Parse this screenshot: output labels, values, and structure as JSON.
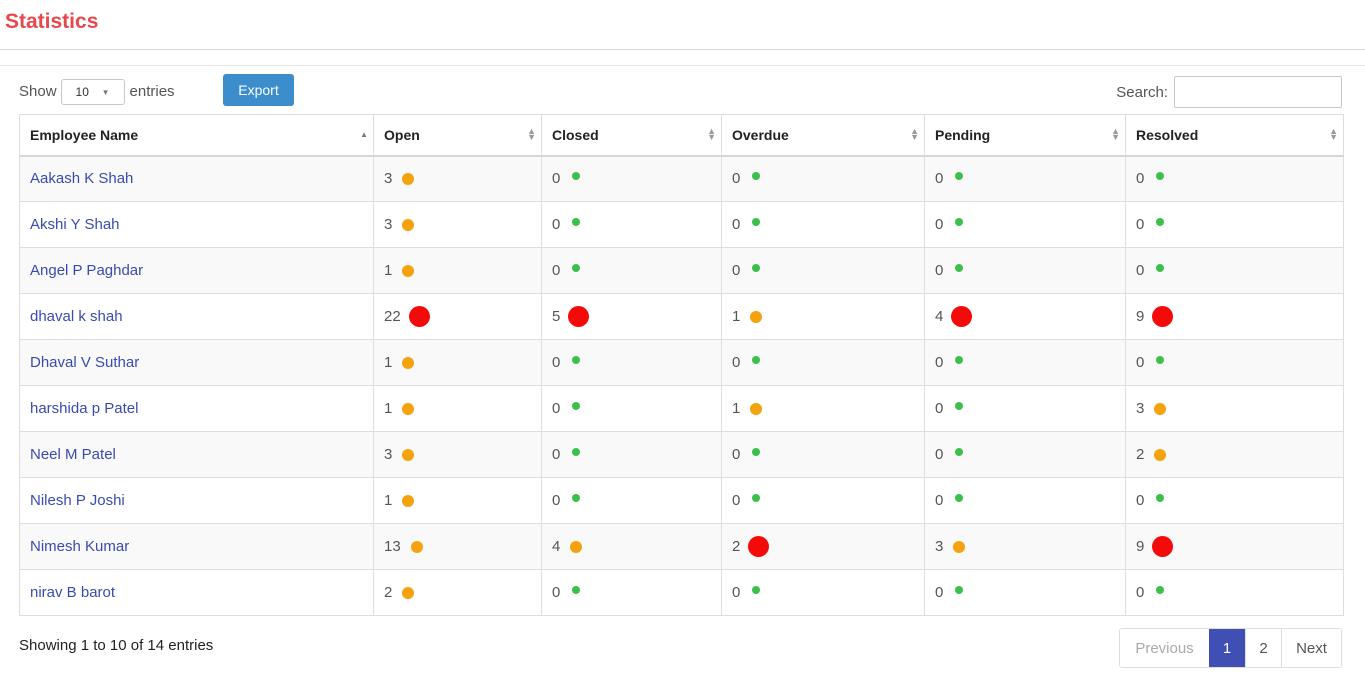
{
  "page": {
    "title": "Statistics"
  },
  "controls": {
    "show_label": "Show",
    "entries_label": "entries",
    "page_length": "10",
    "export_label": "Export",
    "search_label": "Search:",
    "search_value": ""
  },
  "table": {
    "headers": [
      "Employee Name",
      "Open",
      "Closed",
      "Overdue",
      "Pending",
      "Resolved"
    ],
    "rows": [
      {
        "name": "Aakash K Shah",
        "cells": [
          {
            "v": "3",
            "s": "md"
          },
          {
            "v": "0",
            "s": "sm"
          },
          {
            "v": "0",
            "s": "sm"
          },
          {
            "v": "0",
            "s": "sm"
          },
          {
            "v": "0",
            "s": "sm"
          }
        ]
      },
      {
        "name": "Akshi Y Shah",
        "cells": [
          {
            "v": "3",
            "s": "md"
          },
          {
            "v": "0",
            "s": "sm"
          },
          {
            "v": "0",
            "s": "sm"
          },
          {
            "v": "0",
            "s": "sm"
          },
          {
            "v": "0",
            "s": "sm"
          }
        ]
      },
      {
        "name": "Angel P Paghdar",
        "cells": [
          {
            "v": "1",
            "s": "md"
          },
          {
            "v": "0",
            "s": "sm"
          },
          {
            "v": "0",
            "s": "sm"
          },
          {
            "v": "0",
            "s": "sm"
          },
          {
            "v": "0",
            "s": "sm"
          }
        ]
      },
      {
        "name": "dhaval k shah",
        "cells": [
          {
            "v": "22",
            "s": "lg"
          },
          {
            "v": "5",
            "s": "lg"
          },
          {
            "v": "1",
            "s": "md"
          },
          {
            "v": "4",
            "s": "lg"
          },
          {
            "v": "9",
            "s": "lg"
          }
        ]
      },
      {
        "name": "Dhaval V Suthar",
        "cells": [
          {
            "v": "1",
            "s": "md"
          },
          {
            "v": "0",
            "s": "sm"
          },
          {
            "v": "0",
            "s": "sm"
          },
          {
            "v": "0",
            "s": "sm"
          },
          {
            "v": "0",
            "s": "sm"
          }
        ]
      },
      {
        "name": "harshida p Patel",
        "cells": [
          {
            "v": "1",
            "s": "md"
          },
          {
            "v": "0",
            "s": "sm"
          },
          {
            "v": "1",
            "s": "md"
          },
          {
            "v": "0",
            "s": "sm"
          },
          {
            "v": "3",
            "s": "md"
          }
        ]
      },
      {
        "name": "Neel M Patel",
        "cells": [
          {
            "v": "3",
            "s": "md"
          },
          {
            "v": "0",
            "s": "sm"
          },
          {
            "v": "0",
            "s": "sm"
          },
          {
            "v": "0",
            "s": "sm"
          },
          {
            "v": "2",
            "s": "md"
          }
        ]
      },
      {
        "name": "Nilesh P Joshi",
        "cells": [
          {
            "v": "1",
            "s": "md"
          },
          {
            "v": "0",
            "s": "sm"
          },
          {
            "v": "0",
            "s": "sm"
          },
          {
            "v": "0",
            "s": "sm"
          },
          {
            "v": "0",
            "s": "sm"
          }
        ]
      },
      {
        "name": "Nimesh Kumar",
        "cells": [
          {
            "v": "13",
            "s": "md"
          },
          {
            "v": "4",
            "s": "md"
          },
          {
            "v": "2",
            "s": "lg"
          },
          {
            "v": "3",
            "s": "md"
          },
          {
            "v": "9",
            "s": "lg"
          }
        ]
      },
      {
        "name": "nirav B barot",
        "cells": [
          {
            "v": "2",
            "s": "md"
          },
          {
            "v": "0",
            "s": "sm"
          },
          {
            "v": "0",
            "s": "sm"
          },
          {
            "v": "0",
            "s": "sm"
          },
          {
            "v": "0",
            "s": "sm"
          }
        ]
      }
    ]
  },
  "status_colors": {
    "sm": "#3cc04a",
    "md": "#f4a20d",
    "lg": "#f50a0a"
  },
  "footer": {
    "info": "Showing 1 to 10 of 14 entries",
    "previous_label": "Previous",
    "pages": [
      "1",
      "2"
    ],
    "active_page": "1",
    "next_label": "Next"
  }
}
